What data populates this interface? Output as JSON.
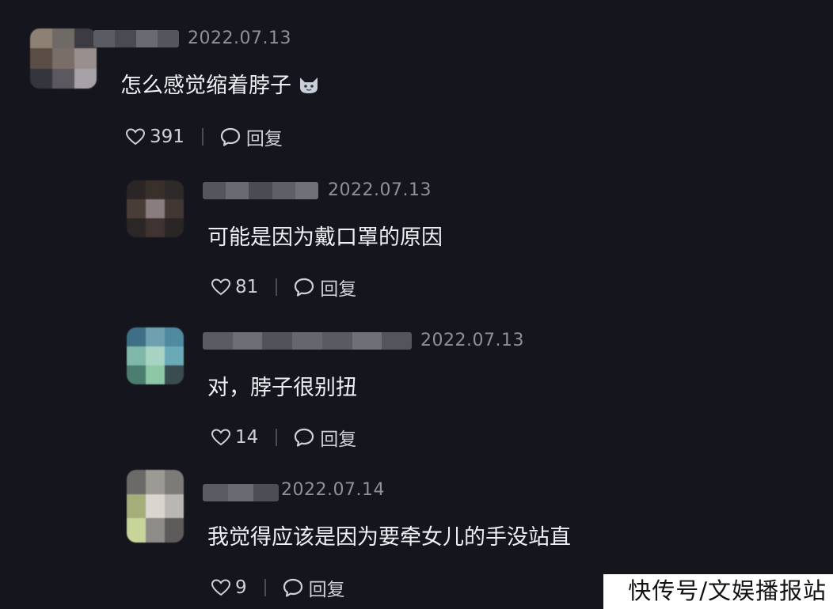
{
  "comments": [
    {
      "date": "2022.07.13",
      "text": "怎么感觉缩着脖子",
      "likes": "391",
      "reply_label": "回复"
    },
    {
      "date": "2022.07.13",
      "text": "可能是因为戴口罩的原因",
      "likes": "81",
      "reply_label": "回复"
    },
    {
      "date": "2022.07.13",
      "text": "对，脖子很别扭",
      "likes": "14",
      "reply_label": "回复"
    },
    {
      "date": "2022.07.14",
      "text": "我觉得应该是因为要牵女儿的手没站直",
      "likes": "9",
      "reply_label": "回复"
    }
  ],
  "watermark": "快传号/文娱播报站",
  "colors": {
    "background": "#15161d",
    "text": "#eef0f4",
    "muted": "#8e909a"
  }
}
